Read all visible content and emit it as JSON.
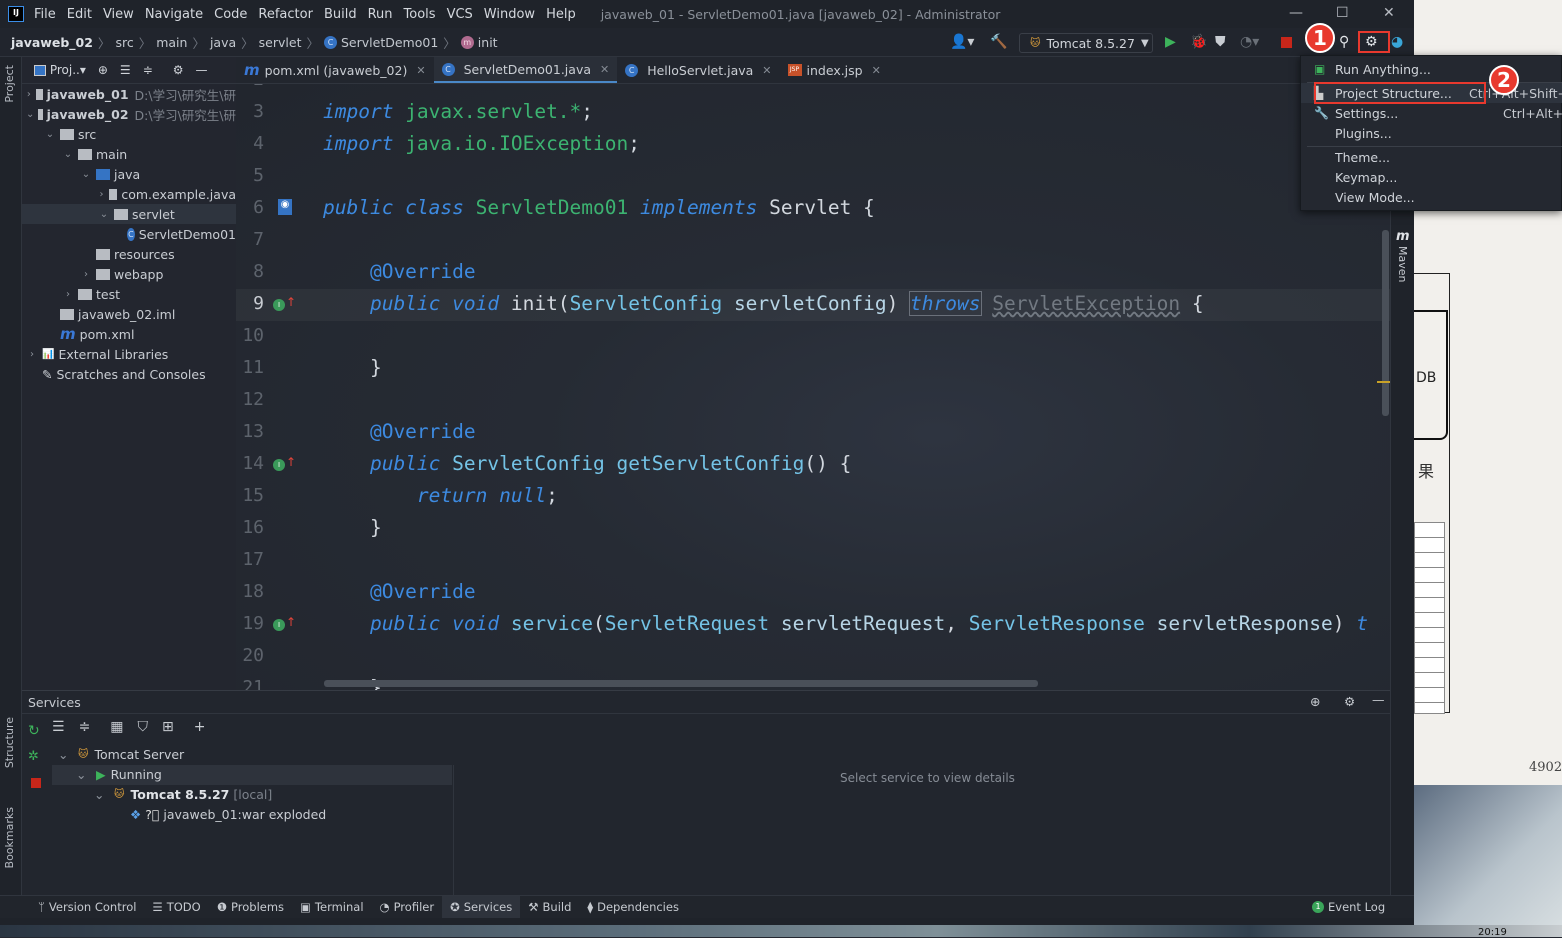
{
  "titlebar": {
    "menu": [
      "File",
      "Edit",
      "View",
      "Navigate",
      "Code",
      "Refactor",
      "Build",
      "Run",
      "Tools",
      "VCS",
      "Window",
      "Help"
    ],
    "title": "javaweb_01 - ServletDemo01.java [javaweb_02] - Administrator"
  },
  "breadcrumb": [
    "javaweb_02",
    "src",
    "main",
    "java",
    "servlet",
    "ServletDemo01",
    "init"
  ],
  "toolbar": {
    "run_config": "Tomcat 8.5.27"
  },
  "project": {
    "header": "Proj..",
    "tree": [
      {
        "label": "javaweb_01",
        "path": "D:\\学习\\研究生\\研",
        "depth": 0,
        "arrow": "›",
        "bold": true
      },
      {
        "label": "javaweb_02",
        "path": "D:\\学习\\研究生\\研",
        "depth": 0,
        "arrow": "⌄",
        "bold": true
      },
      {
        "label": "src",
        "depth": 1,
        "arrow": "⌄"
      },
      {
        "label": "main",
        "depth": 2,
        "arrow": "⌄"
      },
      {
        "label": "java",
        "depth": 3,
        "arrow": "⌄"
      },
      {
        "label": "com.example.java",
        "depth": 4,
        "arrow": "›"
      },
      {
        "label": "servlet",
        "depth": 4,
        "arrow": "⌄",
        "selected": true
      },
      {
        "label": "ServletDemo01",
        "depth": 5,
        "arrow": ""
      },
      {
        "label": "resources",
        "depth": 3,
        "arrow": ""
      },
      {
        "label": "webapp",
        "depth": 3,
        "arrow": "›"
      },
      {
        "label": "test",
        "depth": 2,
        "arrow": "›"
      },
      {
        "label": "javaweb_02.iml",
        "depth": 1,
        "arrow": ""
      },
      {
        "label": "pom.xml",
        "depth": 1,
        "arrow": ""
      },
      {
        "label": "External Libraries",
        "depth": 0,
        "arrow": "›"
      },
      {
        "label": "Scratches and Consoles",
        "depth": 0,
        "arrow": ""
      }
    ]
  },
  "tabs": [
    {
      "label": "pom.xml (javaweb_02)",
      "icon": "maven"
    },
    {
      "label": "ServletDemo01.java",
      "icon": "class",
      "active": true
    },
    {
      "label": "HelloServlet.java",
      "icon": "class"
    },
    {
      "label": "index.jsp",
      "icon": "jsp"
    }
  ],
  "editor": {
    "current_line": 9,
    "lines": [
      {
        "n": 2,
        "tokens": []
      },
      {
        "n": 3,
        "tokens": [
          [
            "import ",
            "kw"
          ],
          [
            "javax.servlet.*",
            "cls"
          ],
          [
            ";",
            "plain"
          ]
        ]
      },
      {
        "n": 4,
        "tokens": [
          [
            "import ",
            "kw"
          ],
          [
            "java.io.IOException",
            "cls"
          ],
          [
            ";",
            "plain"
          ]
        ]
      },
      {
        "n": 5,
        "tokens": []
      },
      {
        "n": 6,
        "tokens": [
          [
            "public class ",
            "kw"
          ],
          [
            "ServletDemo01 ",
            "cls"
          ],
          [
            "implements ",
            "kw"
          ],
          [
            "Servlet {",
            "plain"
          ]
        ]
      },
      {
        "n": 7,
        "tokens": []
      },
      {
        "n": 8,
        "tokens": [
          [
            "    @Override",
            "ann"
          ]
        ]
      },
      {
        "n": 9,
        "tokens": [
          [
            "    public void ",
            "kw"
          ],
          [
            "init",
            "plain"
          ],
          [
            "(",
            "plain"
          ],
          [
            "ServletConfig ",
            "type"
          ],
          [
            "servletConfig",
            "param"
          ],
          [
            ") ",
            "plain"
          ],
          [
            "throws",
            "kw boxed"
          ],
          [
            " ",
            "plain"
          ],
          [
            "ServletException",
            "dim"
          ],
          [
            " {",
            "plain"
          ]
        ]
      },
      {
        "n": 10,
        "tokens": []
      },
      {
        "n": 11,
        "tokens": [
          [
            "    }",
            "plain"
          ]
        ]
      },
      {
        "n": 12,
        "tokens": []
      },
      {
        "n": 13,
        "tokens": [
          [
            "    @Override",
            "ann"
          ]
        ]
      },
      {
        "n": 14,
        "tokens": [
          [
            "    public ",
            "kw"
          ],
          [
            "ServletConfig ",
            "type"
          ],
          [
            "getServletConfig",
            "type"
          ],
          [
            "() {",
            "plain"
          ]
        ]
      },
      {
        "n": 15,
        "tokens": [
          [
            "        return null",
            "kw"
          ],
          [
            ";",
            "plain"
          ]
        ]
      },
      {
        "n": 16,
        "tokens": [
          [
            "    }",
            "plain"
          ]
        ]
      },
      {
        "n": 17,
        "tokens": []
      },
      {
        "n": 18,
        "tokens": [
          [
            "    @Override",
            "ann"
          ]
        ]
      },
      {
        "n": 19,
        "tokens": [
          [
            "    public void ",
            "kw"
          ],
          [
            "service",
            "type"
          ],
          [
            "(",
            "plain"
          ],
          [
            "ServletRequest ",
            "type"
          ],
          [
            "servletRequest",
            "param"
          ],
          [
            ", ",
            "plain"
          ],
          [
            "ServletResponse ",
            "type"
          ],
          [
            "servletResponse",
            "param"
          ],
          [
            ") ",
            "plain"
          ],
          [
            "t",
            "kw"
          ]
        ]
      },
      {
        "n": 20,
        "tokens": []
      },
      {
        "n": 21,
        "tokens": [
          [
            "    }",
            "plain"
          ]
        ]
      }
    ]
  },
  "right_stripe": {
    "maven": "Maven"
  },
  "left_stripe": {
    "project": "Project",
    "structure": "Structure",
    "bookmarks": "Bookmarks"
  },
  "services": {
    "title": "Services",
    "empty": "Select service to view details",
    "tree": [
      {
        "label": "Tomcat Server"
      },
      {
        "label": "Running"
      },
      {
        "label": "Tomcat 8.5.27",
        "suffix": "[local]"
      },
      {
        "label": "javaweb_01:war exploded"
      }
    ]
  },
  "bottom_tools": [
    "Version Control",
    "TODO",
    "Problems",
    "Terminal",
    "Profiler",
    "Services",
    "Build",
    "Dependencies"
  ],
  "event_log": "Event Log",
  "popup": {
    "items": [
      {
        "label": "Run Anything..."
      },
      {
        "label": "Project Structure...",
        "shortcut": "Ctrl+Alt+Shift+S"
      },
      {
        "label": "Settings...",
        "shortcut": "Ctrl+Alt+S"
      },
      {
        "label": "Plugins..."
      },
      {
        "label": "Theme..."
      },
      {
        "label": "Keymap..."
      },
      {
        "label": "View Mode..."
      }
    ]
  },
  "annotations": [
    "1",
    "2"
  ],
  "background_doc": {
    "db": "DB",
    "char": "果",
    "number": "4902"
  },
  "taskbar": {
    "time": "20:19"
  },
  "colors": {
    "accent": "#3d8ae0",
    "annotation_red": "#e8392e",
    "run_green": "#3cb371"
  }
}
